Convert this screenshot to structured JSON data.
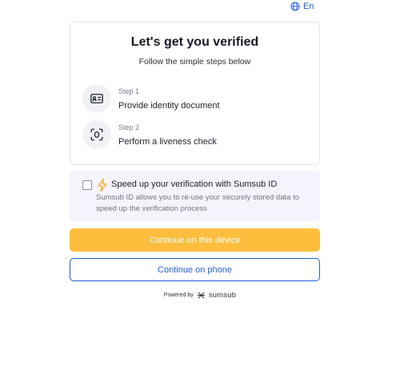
{
  "language": {
    "label": "En",
    "icon": "globe-icon"
  },
  "card": {
    "title": "Let's get you verified",
    "subtitle": "Follow the simple steps below",
    "steps": [
      {
        "label": "Step 1",
        "title": "Provide identity document",
        "icon": "id-card-icon"
      },
      {
        "label": "Step 2",
        "title": "Perform a liveness check",
        "icon": "face-scan-icon"
      }
    ]
  },
  "sumsub_id": {
    "checked": false,
    "icon": "lightning-icon",
    "title": "Speed up your verification with Sumsub ID",
    "description": "Sumsub ID allows you to re-use your securely stored data to speed up the verification process"
  },
  "buttons": {
    "continue_device": "Continue on this device",
    "continue_phone": "Continue on phone"
  },
  "footer": {
    "powered_by": "Powered by",
    "brand": "sumsub",
    "logo_icon": "sumsub-logo-icon"
  },
  "colors": {
    "accent": "#1f5fd6",
    "primary_button": "#fdbd3d",
    "bolt": "#f7a823",
    "sumsub_box_bg": "#f5f3fc"
  }
}
